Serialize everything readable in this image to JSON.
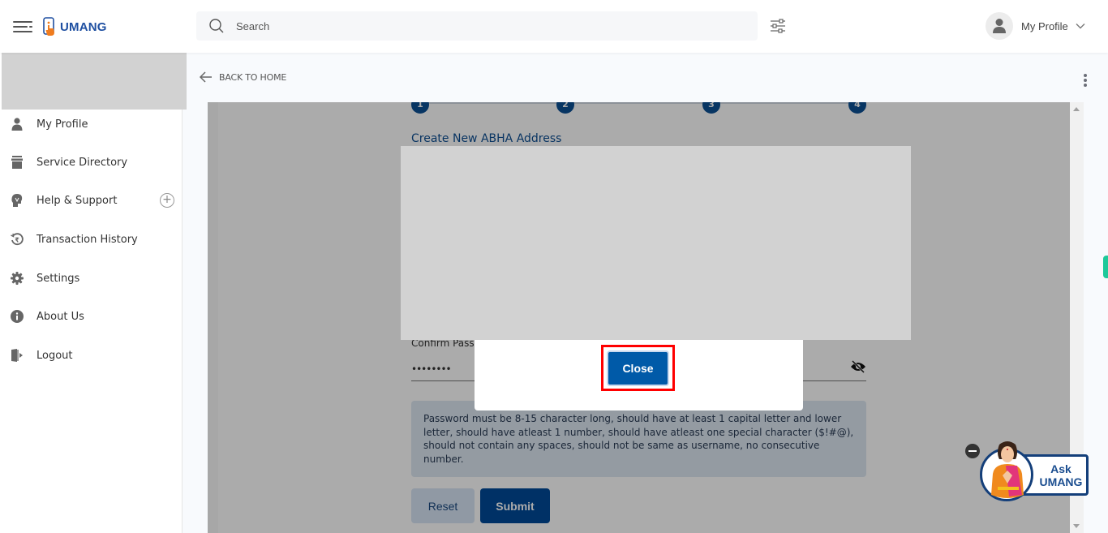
{
  "app": {
    "brand": "UMANG",
    "brand_color": "#1e4fa1"
  },
  "header": {
    "search_placeholder": "Search",
    "profile_label": "My Profile",
    "icons": {
      "menu": "hamburger-icon",
      "search": "search-icon",
      "filter": "sliders-icon",
      "avatar": "user-icon",
      "dropdown": "chevron-down-icon"
    }
  },
  "sidebar": {
    "items": [
      {
        "label": "My Profile",
        "icon": "user-icon"
      },
      {
        "label": "Service Directory",
        "icon": "archive-icon"
      },
      {
        "label": "Help & Support",
        "icon": "support-icon",
        "expandable": true
      },
      {
        "label": "Transaction History",
        "icon": "rupee-history-icon"
      },
      {
        "label": "Settings",
        "icon": "gear-icon"
      },
      {
        "label": "About Us",
        "icon": "info-icon"
      },
      {
        "label": "Logout",
        "icon": "logout-icon"
      }
    ],
    "expand_symbol": "+"
  },
  "main": {
    "back_label": "BACK TO HOME",
    "steps": [
      "1",
      "2",
      "3",
      "4"
    ],
    "form_title": "Create New ABHA Address",
    "confirm_password_label": "Confirm Password",
    "confirm_password_value": "••••••••",
    "password_hint": "Password must be 8-15 character long, should have at least 1 capital letter and lower letter, should have atleast 1 number, should have atleast one special character ($!#@), should not contain any spaces, should not be same as username, no consecutive number.",
    "reset_label": "Reset",
    "submit_label": "Submit"
  },
  "modal": {
    "close_label": "Close",
    "primary_color": "#005aa8"
  },
  "assistant": {
    "line1": "Ask",
    "line2": "UMANG"
  },
  "colors": {
    "accent": "#004a99",
    "step": "#0b4f94",
    "highlight": "#ff0000",
    "side_tab": "#1ec99a"
  }
}
